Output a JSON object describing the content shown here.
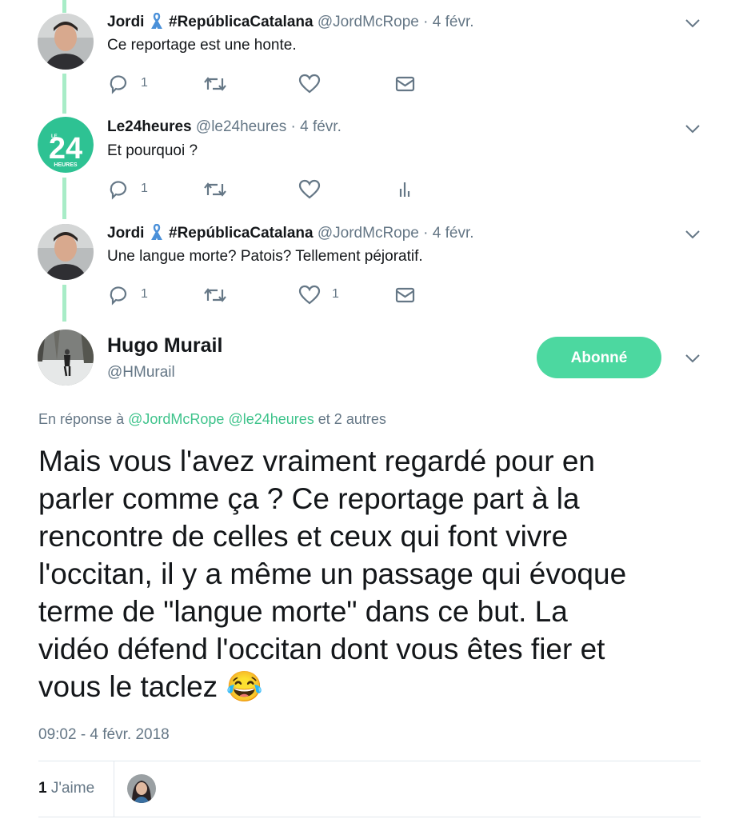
{
  "tweets": [
    {
      "name": "Jordi",
      "tag": "#RepúblicaCatalana",
      "handle": "@JordMcRope",
      "separator": "·",
      "date": "4 févr.",
      "text": "Ce reportage est une honte.",
      "reply_count": "1",
      "like_count": ""
    },
    {
      "name": "Le24heures",
      "tag": "",
      "handle": "@le24heures",
      "separator": "·",
      "date": "4 févr.",
      "text": "Et pourquoi ?",
      "reply_count": "1",
      "like_count": ""
    },
    {
      "name": "Jordi",
      "tag": "#RepúblicaCatalana",
      "handle": "@JordMcRope",
      "separator": "·",
      "date": "4 févr.",
      "text": "Une langue morte? Patois? Tellement péjoratif.",
      "reply_count": "1",
      "like_count": "1"
    }
  ],
  "logo": {
    "top": "LE",
    "number": "24",
    "bottom": "HEURES"
  },
  "main": {
    "name": "Hugo Murail",
    "handle": "@HMurail",
    "follow_label": "Abonné",
    "reply_prefix": "En réponse à",
    "reply_mentions": [
      "@JordMcRope",
      "@le24heures"
    ],
    "reply_suffix": "et 2 autres",
    "text_lines": [
      "Mais vous l'avez vraiment regardé pour en",
      "parler comme ça ?  Ce reportage part à la",
      "rencontre de celles et ceux qui font vivre",
      "l'occitan, il y a même un passage qui évoque",
      "terme de \"langue morte\" dans ce but. La",
      "vidéo défend l'occitan dont vous êtes fier et",
      "vous le taclez"
    ],
    "emoji": "😂",
    "timestamp": "09:02 - 4 févr. 2018",
    "likes_count": "1",
    "likes_label": "J'aime"
  },
  "colors": {
    "accent": "#4cd8a0",
    "thread_line": "#a8ecc7",
    "link": "#3ec38b",
    "muted": "#657786"
  },
  "icons": [
    "reply-icon",
    "retweet-icon",
    "heart-icon",
    "message-icon",
    "analytics-icon",
    "chevron-down-icon",
    "blue-ribbon-icon"
  ]
}
